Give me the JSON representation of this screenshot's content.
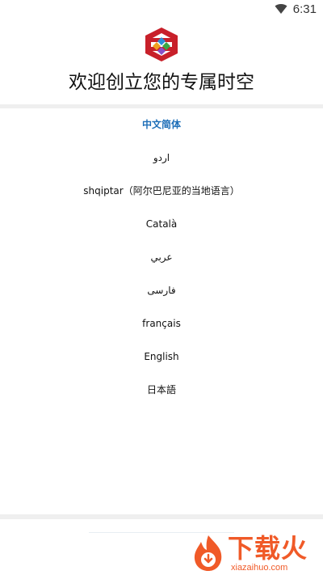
{
  "status_bar": {
    "time": "6:31",
    "wifi_icon": "wifi-icon"
  },
  "header": {
    "logo_icon": "app-logo-icon",
    "title": "欢迎创立您的专属时空"
  },
  "languages": {
    "selected_index": 0,
    "items": [
      {
        "label": "中文简体"
      },
      {
        "label": "اردو"
      },
      {
        "label": "shqiptar（阿尔巴尼亚的当地语言）"
      },
      {
        "label": "Català"
      },
      {
        "label": "عربي"
      },
      {
        "label": "فارسی"
      },
      {
        "label": "français"
      },
      {
        "label": "English"
      },
      {
        "label": "日本語"
      }
    ]
  },
  "watermark": {
    "text": "下载火",
    "url": "xiazaihuo.com",
    "icon": "flame-logo-icon"
  },
  "colors": {
    "selected_text": "#1e6fb8",
    "divider": "#efefef",
    "watermark": "#f05a28",
    "logo_red": "#c8202a"
  }
}
